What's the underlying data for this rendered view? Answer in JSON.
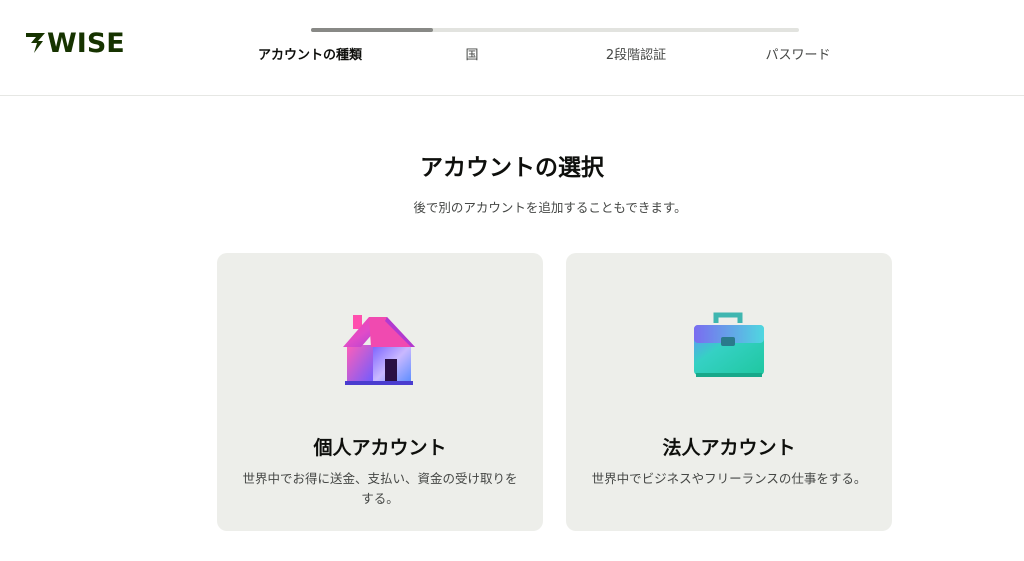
{
  "brand": {
    "logo_text": "WISE",
    "logo_color": "#163300"
  },
  "progress": {
    "fraction_complete": 0.25,
    "steps": [
      {
        "label": "アカウントの種類",
        "active": true
      },
      {
        "label": "国",
        "active": false
      },
      {
        "label": "2段階認証",
        "active": false
      },
      {
        "label": "パスワード",
        "active": false
      }
    ]
  },
  "main": {
    "title": "アカウントの選択",
    "subtitle": "後で別のアカウントを追加することもできます。"
  },
  "cards": [
    {
      "icon": "house-icon",
      "title": "個人アカウント",
      "description": "世界中でお得に送金、支払い、資金の受け取りをする。"
    },
    {
      "icon": "briefcase-icon",
      "title": "法人アカウント",
      "description": "世界中でビジネスやフリーランスの仕事をする。"
    }
  ],
  "colors": {
    "card_background": "#edeeea",
    "text_primary": "#0e0f0c",
    "text_secondary": "#454745"
  }
}
